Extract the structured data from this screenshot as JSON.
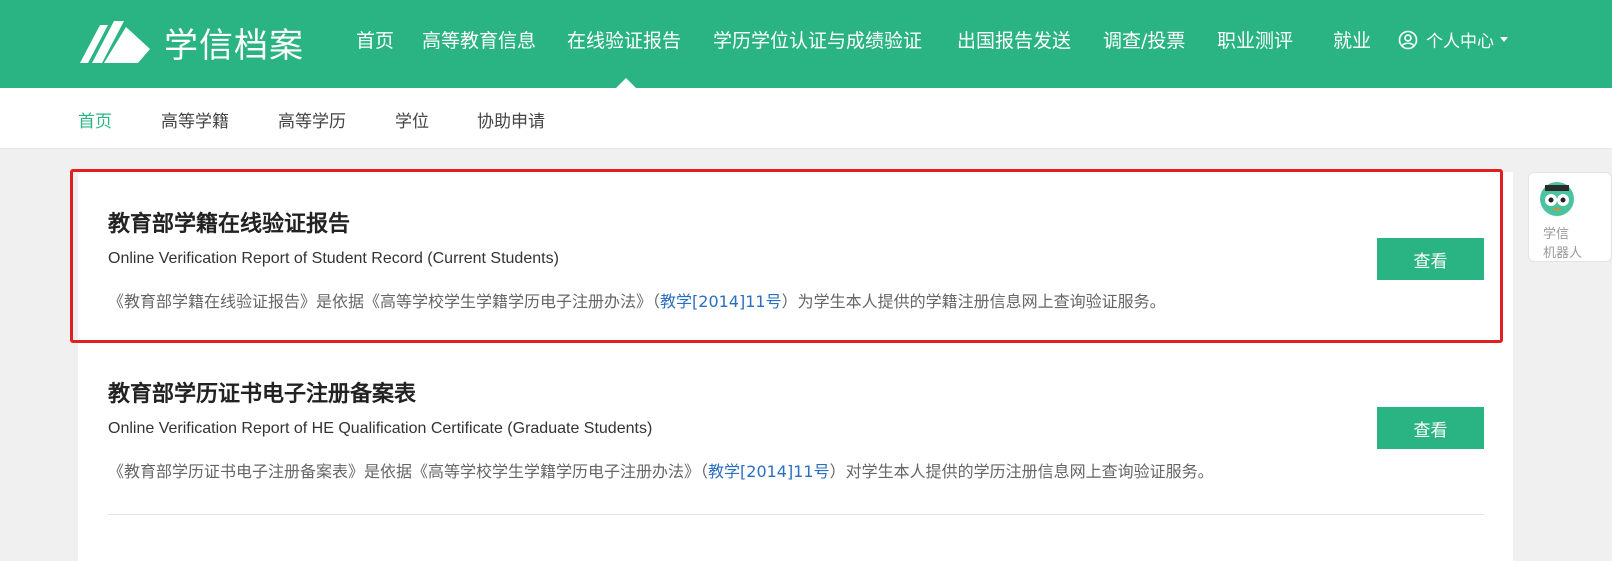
{
  "header": {
    "logo_text": "学信档案",
    "nav": [
      {
        "label": "首页"
      },
      {
        "label": "高等教育信息"
      },
      {
        "label": "在线验证报告"
      },
      {
        "label": "学历学位认证与成绩验证"
      },
      {
        "label": "出国报告发送"
      },
      {
        "label": "调查/投票"
      },
      {
        "label": "职业测评"
      },
      {
        "label": "就业"
      }
    ],
    "active_index": 2,
    "user_label": "个人中心"
  },
  "subnav": {
    "items": [
      {
        "label": "首页"
      },
      {
        "label": "高等学籍"
      },
      {
        "label": "高等学历"
      },
      {
        "label": "学位"
      },
      {
        "label": "协助申请"
      }
    ],
    "active_index": 0
  },
  "cards": [
    {
      "title": "教育部学籍在线验证报告",
      "subtitle": "Online Verification Report of Student Record (Current Students)",
      "desc_before": "《教育部学籍在线验证报告》是依据《高等学校学生学籍学历电子注册办法》（",
      "desc_link": "教学[2014]11号",
      "desc_after": "）为学生本人提供的学籍注册信息网上查询验证服务。",
      "button": "查看"
    },
    {
      "title": "教育部学历证书电子注册备案表",
      "subtitle": "Online Verification Report of HE Qualification Certificate (Graduate Students)",
      "desc_before": "《教育部学历证书电子注册备案表》是依据《高等学校学生学籍学历电子注册办法》（",
      "desc_link": "教学[2014]11号",
      "desc_after": "）对学生本人提供的学历注册信息网上查询验证服务。",
      "button": "查看"
    }
  ],
  "robot": {
    "line1": "学信",
    "line2": "机器人"
  },
  "colors": {
    "brand": "#2bb483",
    "link": "#2a6fc0",
    "highlight": "#e02020"
  }
}
